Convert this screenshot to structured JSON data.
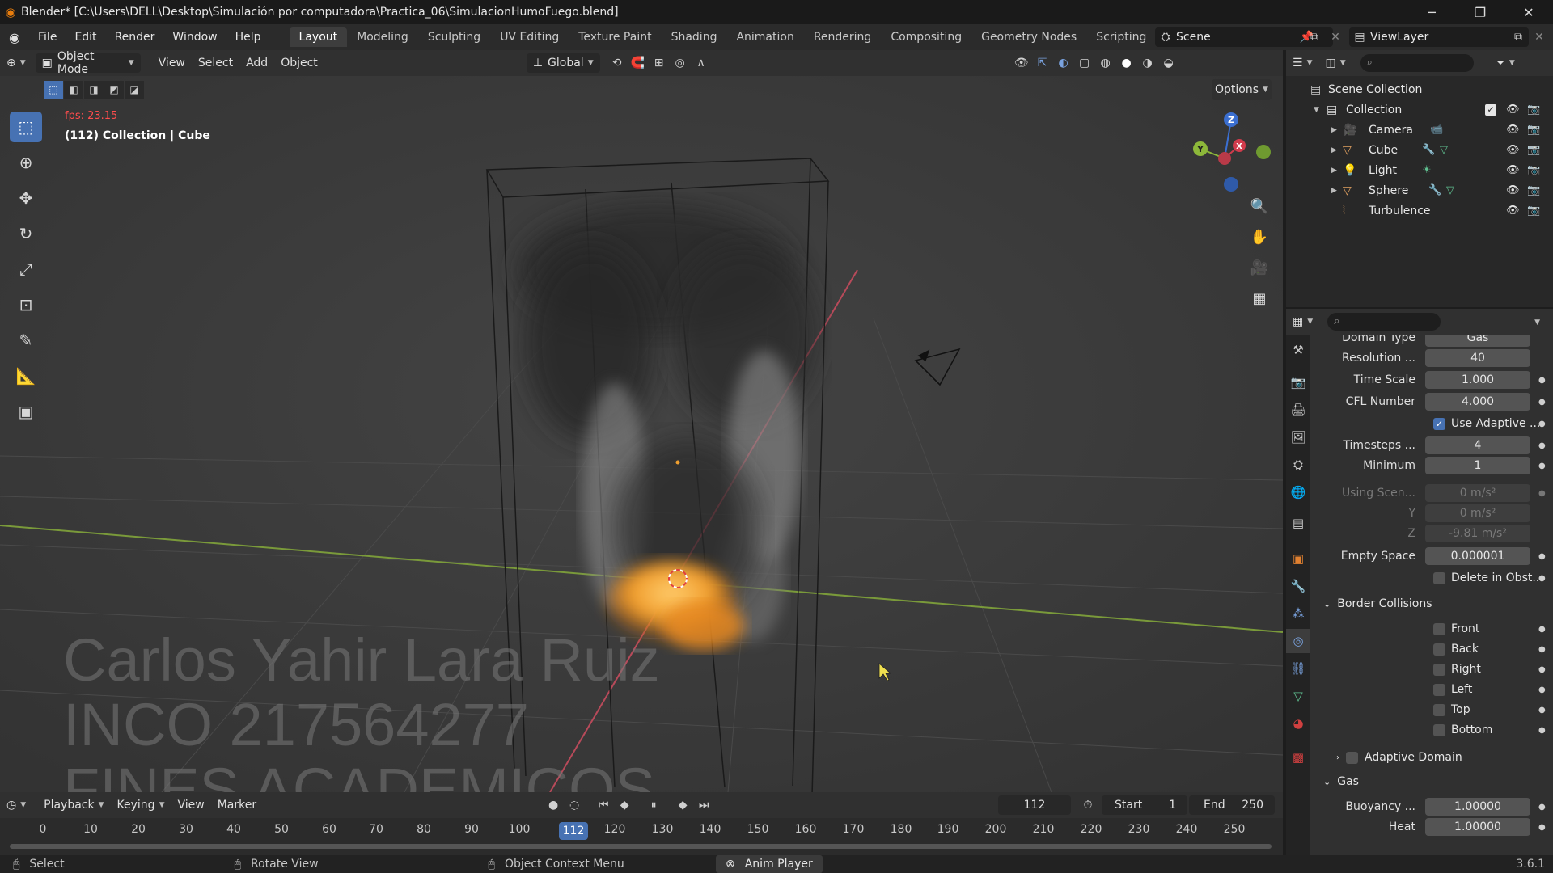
{
  "window": {
    "title": "Blender* [C:\\Users\\DELL\\Desktop\\Simulación por computadora\\Practica_06\\SimulacionHumoFuego.blend]"
  },
  "menu": [
    "File",
    "Edit",
    "Render",
    "Window",
    "Help"
  ],
  "workspaces": {
    "active": "Layout",
    "tabs": [
      "Layout",
      "Modeling",
      "Sculpting",
      "UV Editing",
      "Texture Paint",
      "Shading",
      "Animation",
      "Rendering",
      "Compositing",
      "Geometry Nodes",
      "Scripting"
    ]
  },
  "scene": {
    "name": "Scene",
    "view_layer": "ViewLayer"
  },
  "viewport_header": {
    "mode": "Object Mode",
    "menus": [
      "View",
      "Select",
      "Add",
      "Object"
    ],
    "transform_orientation": "Global",
    "options_label": "Options"
  },
  "viewport": {
    "fps": "fps: 23.15",
    "info": "(112) Collection | Cube",
    "watermark": [
      "Carlos Yahir Lara Ruiz",
      "INCO 217564277",
      "FINES ACADEMICOS"
    ]
  },
  "timeline": {
    "menus": [
      "Playback",
      "Keying",
      "View",
      "Marker"
    ],
    "current_frame": "112",
    "start_label": "Start",
    "start": "1",
    "end_label": "End",
    "end": "250",
    "ticks": [
      "0",
      "10",
      "20",
      "30",
      "40",
      "50",
      "60",
      "70",
      "80",
      "90",
      "100",
      "120",
      "130",
      "140",
      "150",
      "160",
      "170",
      "180",
      "190",
      "200",
      "210",
      "220",
      "230",
      "240",
      "250"
    ]
  },
  "status_bar": {
    "select": "Select",
    "rotate": "Rotate View",
    "context": "Object Context Menu",
    "anim_player": "Anim Player",
    "version": "3.6.1"
  },
  "outliner": {
    "root": "Scene Collection",
    "collection": "Collection",
    "items": [
      {
        "name": "Camera",
        "icon": "camera-icon",
        "color": "#e0a060"
      },
      {
        "name": "Cube",
        "icon": "mesh-icon",
        "color": "#e0a060"
      },
      {
        "name": "Light",
        "icon": "light-icon",
        "color": "#e0a060"
      },
      {
        "name": "Sphere",
        "icon": "mesh-icon",
        "color": "#e0a060"
      },
      {
        "name": "Turbulence",
        "icon": "force-field-icon",
        "color": "#e0a060"
      }
    ]
  },
  "properties": {
    "domain_type_label": "Domain Type",
    "domain_type": "Gas",
    "resolution_label": "Resolution ...",
    "resolution": "40",
    "time_scale_label": "Time Scale",
    "time_scale": "1.000",
    "cfl_label": "CFL Number",
    "cfl": "4.000",
    "adaptive_label": "Use Adaptive ...",
    "timesteps_label": "Timesteps ...",
    "timesteps": "4",
    "minimum_label": "Minimum",
    "minimum": "1",
    "gravity_label": "Using Scen...",
    "gravity_x": "0 m/s²",
    "gravity_y_label": "Y",
    "gravity_y": "0 m/s²",
    "gravity_z_label": "Z",
    "gravity_z": "-9.81 m/s²",
    "empty_space_label": "Empty Space",
    "empty_space": "0.000001",
    "delete_label": "Delete in Obst...",
    "border_collisions_label": "Border Collisions",
    "borders": [
      "Front",
      "Back",
      "Right",
      "Left",
      "Top",
      "Bottom"
    ],
    "adaptive_domain_label": "Adaptive Domain",
    "gas_label": "Gas",
    "buoyancy_label": "Buoyancy ...",
    "buoyancy": "1.00000",
    "heat_label": "Heat",
    "heat": "1.00000"
  },
  "colors": {
    "accent": "#4772b3",
    "fire": "#f0a030",
    "fps": "#ff4d4d"
  }
}
